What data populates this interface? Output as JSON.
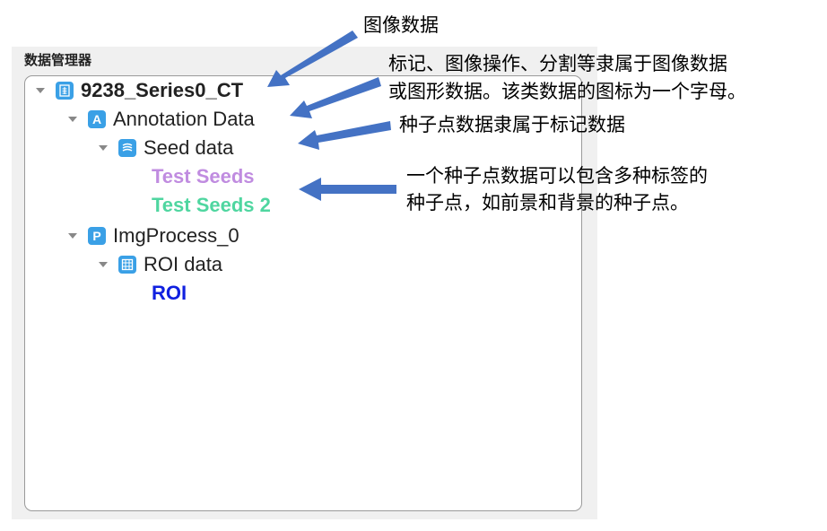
{
  "panel": {
    "title": "数据管理器"
  },
  "tree": {
    "root": {
      "label": "9238_Series0_CT"
    },
    "annotation": {
      "icon_letter": "A",
      "label": "Annotation Data"
    },
    "seed": {
      "label": "Seed data"
    },
    "seeds": [
      {
        "label": "Test Seeds",
        "color": "#c08ce0"
      },
      {
        "label": "Test Seeds 2",
        "color": "#4fd6a0"
      }
    ],
    "imgprocess": {
      "icon_letter": "P",
      "label": "ImgProcess_0"
    },
    "roi_group": {
      "label": "ROI data"
    },
    "roi": {
      "label": "ROI",
      "color": "#1020e0"
    }
  },
  "annotations": {
    "image_data": "图像数据",
    "marker_line1": "标记、图像操作、分割等隶属于图像数据",
    "marker_line2": "或图形数据。该类数据的图标为一个字母。",
    "seed_note": "种子点数据隶属于标记数据",
    "multi_line1": "一个种子点数据可以包含多种标签的",
    "multi_line2": "种子点，如前景和背景的种子点。"
  },
  "colors": {
    "icon_blue": "#3aa0e6",
    "arrow_blue": "#4472c4"
  },
  "icons": [
    "image-series-icon",
    "annotation-letter-icon",
    "seed-data-icon",
    "imgprocess-letter-icon",
    "roi-data-icon"
  ]
}
